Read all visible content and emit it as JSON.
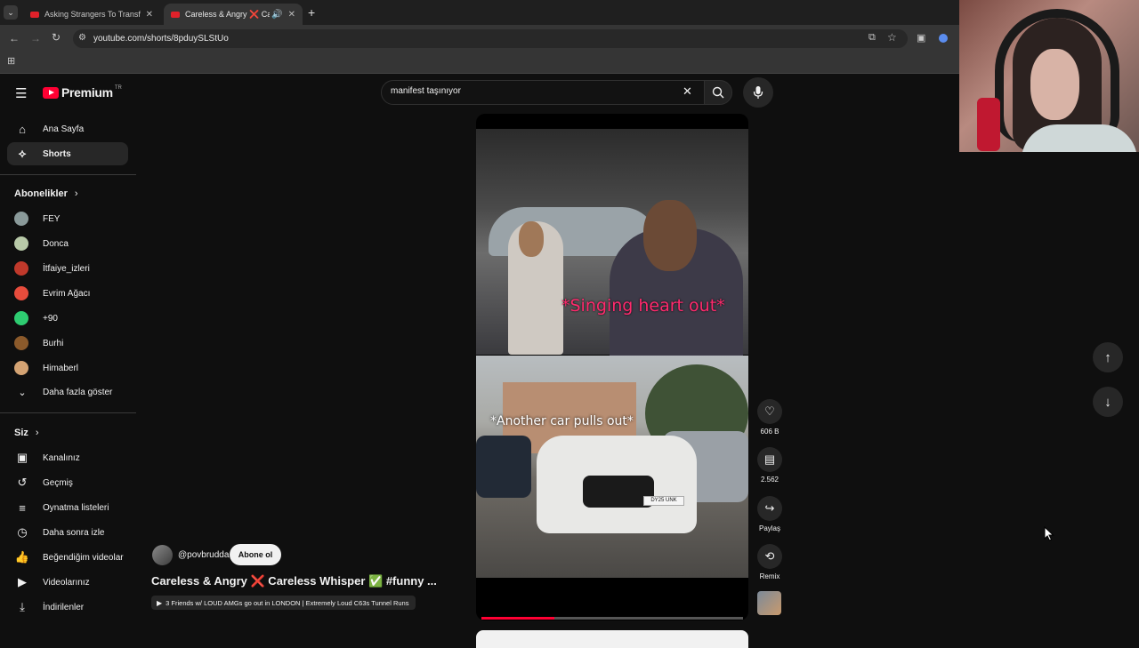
{
  "browser": {
    "tabs": [
      {
        "title": "Asking Strangers To Transform"
      },
      {
        "title": "Careless & Angry ❌ Careless"
      }
    ],
    "url": "youtube.com/shorts/8pduySLStUo"
  },
  "youtube": {
    "logo_text": "Premium",
    "logo_region": "TR",
    "search_value": "manifest taşınıyor",
    "nav": [
      {
        "label": "Ana Sayfa",
        "icon": "home-icon"
      },
      {
        "label": "Shorts",
        "icon": "shorts-icon"
      }
    ],
    "subscriptions_title": "Abonelikler",
    "subscriptions": [
      {
        "label": "FEY",
        "color": "#8a9a9a"
      },
      {
        "label": "Donca",
        "color": "#b8c9a8"
      },
      {
        "label": "İtfaiye_izleri",
        "color": "#c0392b"
      },
      {
        "label": "Evrim Ağacı",
        "color": "#e74c3c"
      },
      {
        "label": "+90",
        "color": "#2ecc71"
      },
      {
        "label": "Burhi",
        "color": "#8b5a2b"
      },
      {
        "label": "Himaberl",
        "color": "#d4a373"
      }
    ],
    "show_more": "Daha fazla göster",
    "you_title": "Siz",
    "you_items": [
      {
        "label": "Kanalınız",
        "icon": "channel-icon"
      },
      {
        "label": "Geçmiş",
        "icon": "history-icon"
      },
      {
        "label": "Oynatma listeleri",
        "icon": "playlists-icon"
      },
      {
        "label": "Daha sonra izle",
        "icon": "clock-icon"
      },
      {
        "label": "Beğendiğim videolar",
        "icon": "thumbs-up-icon"
      },
      {
        "label": "Videolarınız",
        "icon": "video-icon"
      },
      {
        "label": "İndirilenler",
        "icon": "download-icon"
      }
    ]
  },
  "short": {
    "caption_top": "*Singing heart out*",
    "caption_bottom": "*Another car pulls out*",
    "channel": "@povbrudda",
    "subscribe": "Abone ol",
    "title": "Careless & Angry ❌ Careless Whisper ✅ #funny ...",
    "related": "3 Friends w/ LOUD AMGs go out in LONDON | Extremely Loud C63s Tunnel Runs",
    "likes": "606 B",
    "comments": "2.562",
    "share": "Paylaş",
    "remix": "Remix",
    "progress": 0.28,
    "plate": "DY25 UNK"
  },
  "colors": {
    "accent_red": "#ff0033",
    "caption_pink": "#ff2a6d"
  }
}
